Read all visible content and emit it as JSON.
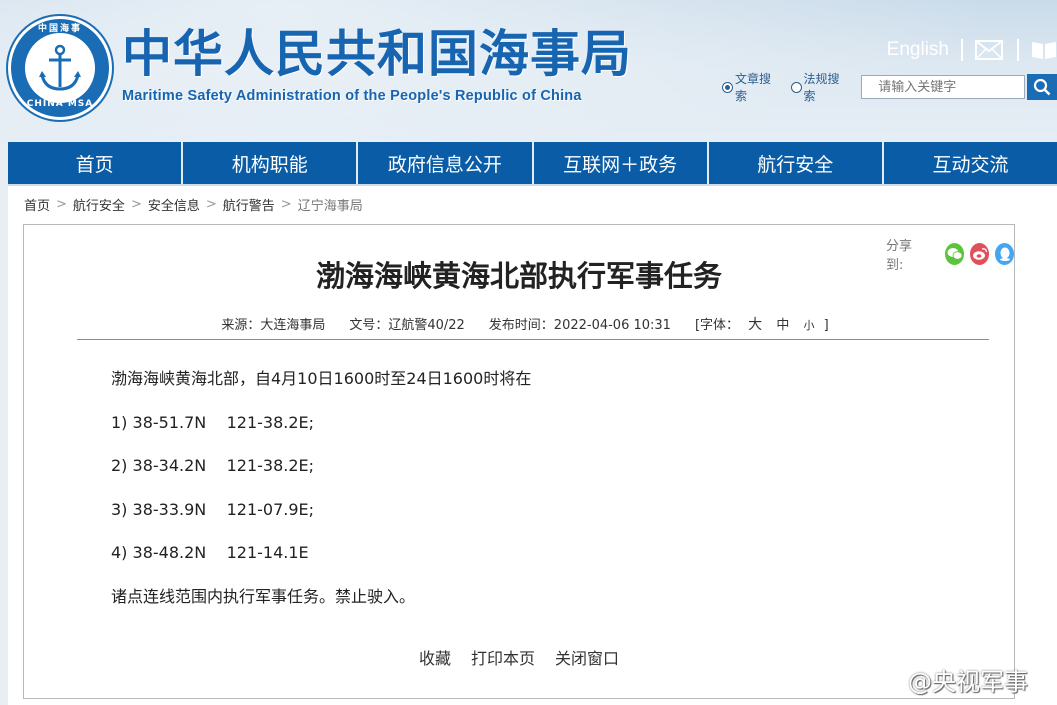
{
  "header": {
    "logo": {
      "text_cn": "中国海事",
      "text_en": "CHINA MSA"
    },
    "title": "中华人民共和国海事局",
    "subtitle": "Maritime Safety Administration of the People's Republic of China",
    "english_link": "English",
    "mail_icon": "mail-icon",
    "book_icon": "book-icon"
  },
  "search": {
    "option_articles": "文章搜索",
    "option_regulations": "法规搜索",
    "selected": "文章搜索",
    "placeholder": "请输入关键字"
  },
  "nav": {
    "items": [
      "首页",
      "机构职能",
      "政府信息公开",
      "互联网＋政务",
      "航行安全",
      "互动交流"
    ]
  },
  "breadcrumb": [
    "首页",
    "航行安全",
    "安全信息",
    "航行警告",
    "辽宁海事局"
  ],
  "article": {
    "share_label": "分享到:",
    "share_icons": [
      "wechat-icon",
      "weibo-icon",
      "qq-icon"
    ],
    "title": "渤海海峡黄海北部执行军事任务",
    "source": "来源：大连海事局",
    "doc_no": "文号：辽航警40/22",
    "published": "发布时间：2022-04-06 10:31",
    "font_label": "[字体：",
    "font_large": "大",
    "font_medium": "中",
    "font_small": "小",
    "font_close": "]",
    "paragraphs": [
      "渤海海峡黄海北部，自4月10日1600时至24日1600时将在",
      "1) 38-51.7N    121-38.2E;",
      "2) 38-34.2N    121-38.2E;",
      "3) 38-33.9N    121-07.9E;",
      "4) 38-48.2N    121-14.1E",
      "诸点连线范围内执行军事任务。禁止驶入。"
    ],
    "actions": [
      "收藏",
      "打印本页",
      "关闭窗口"
    ]
  },
  "watermark": "@央视军事",
  "colors": {
    "brand_blue": "#0b5ca7",
    "title_blue": "#1764b1",
    "wechat_green": "#5ac43c",
    "weibo_red": "#e0505a",
    "qq_blue": "#46a5ef"
  }
}
